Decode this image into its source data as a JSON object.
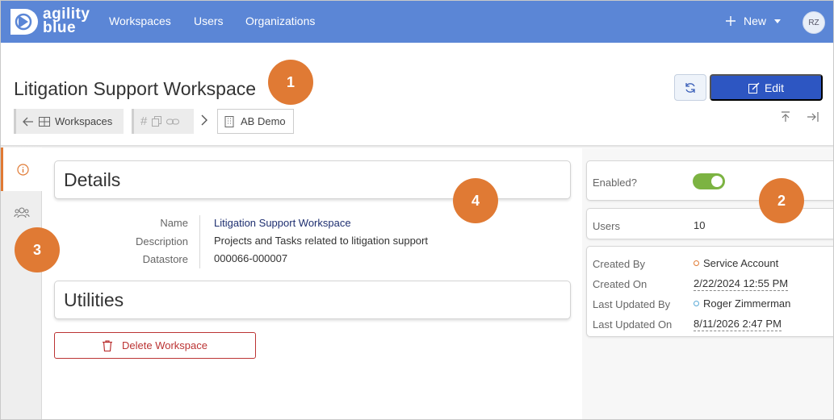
{
  "nav": {
    "logo_line1": "agility",
    "logo_line2": "blue",
    "links": [
      "Workspaces",
      "Users",
      "Organizations"
    ],
    "new_label": "New",
    "avatar_initials": "RZ",
    "bar_color": "#5b86d6"
  },
  "header": {
    "title": "Litigation Support Workspace",
    "breadcrumb_workspaces": "Workspaces",
    "breadcrumb_current": "AB Demo",
    "edit_label": "Edit"
  },
  "details": {
    "heading": "Details",
    "rows": [
      {
        "label": "Name",
        "value": "Litigation Support Workspace"
      },
      {
        "label": "Description",
        "value": "Projects and Tasks related to litigation support"
      },
      {
        "label": "Datastore",
        "value": "000066-000007"
      }
    ]
  },
  "utilities": {
    "heading": "Utilities",
    "delete_label": "Delete Workspace"
  },
  "side": {
    "enabled_label": "Enabled?",
    "enabled": true,
    "users_label": "Users",
    "users_value": "10",
    "created_by_label": "Created By",
    "created_by_value": "Service Account",
    "created_on_label": "Created On",
    "created_on_value": "2/22/2024 12:55 PM",
    "updated_by_label": "Last Updated By",
    "updated_by_value": "Roger Zimmerman",
    "updated_on_label": "Last Updated On",
    "updated_on_value": "8/11/2026 2:47 PM"
  },
  "callouts": [
    "1",
    "2",
    "3",
    "4"
  ],
  "colors": {
    "accent": "#e07a34",
    "primary_button": "#2d56c2",
    "toggle_on": "#7cb342",
    "danger": "#b33333"
  }
}
